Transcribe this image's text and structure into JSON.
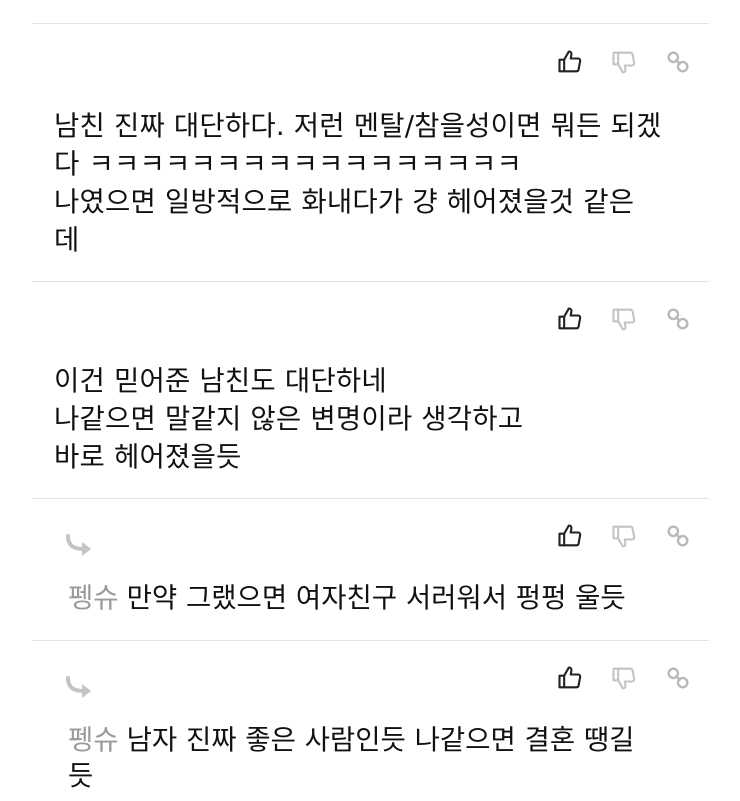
{
  "comments": [
    {
      "text": "남친 진짜 대단하다. 저런 멘탈/참을성이면 뭐든 되겠\n다 ㅋㅋㅋㅋㅋㅋㅋㅋㅋㅋㅋㅋㅋㅋㅋㅋㅋ\n나였으면 일방적으로 화내다가 걍 헤어졌을것 같은\n데"
    },
    {
      "text": "이건 믿어준 남친도 대단하네\n나같으면 말같지 않은 변명이라 생각하고\n바로 헤어졌을듯"
    }
  ],
  "replies": [
    {
      "author": "펭슈",
      "text": "만약 그랬으면 여자친구 서러워서 펑펑 울듯"
    },
    {
      "author": "펭슈",
      "text": "남자 진짜 좋은 사람인듯 나같으면 결혼 땡길\n듯"
    }
  ],
  "icons": [
    "thumbs-up-icon",
    "thumbs-down-icon",
    "link-icon"
  ]
}
